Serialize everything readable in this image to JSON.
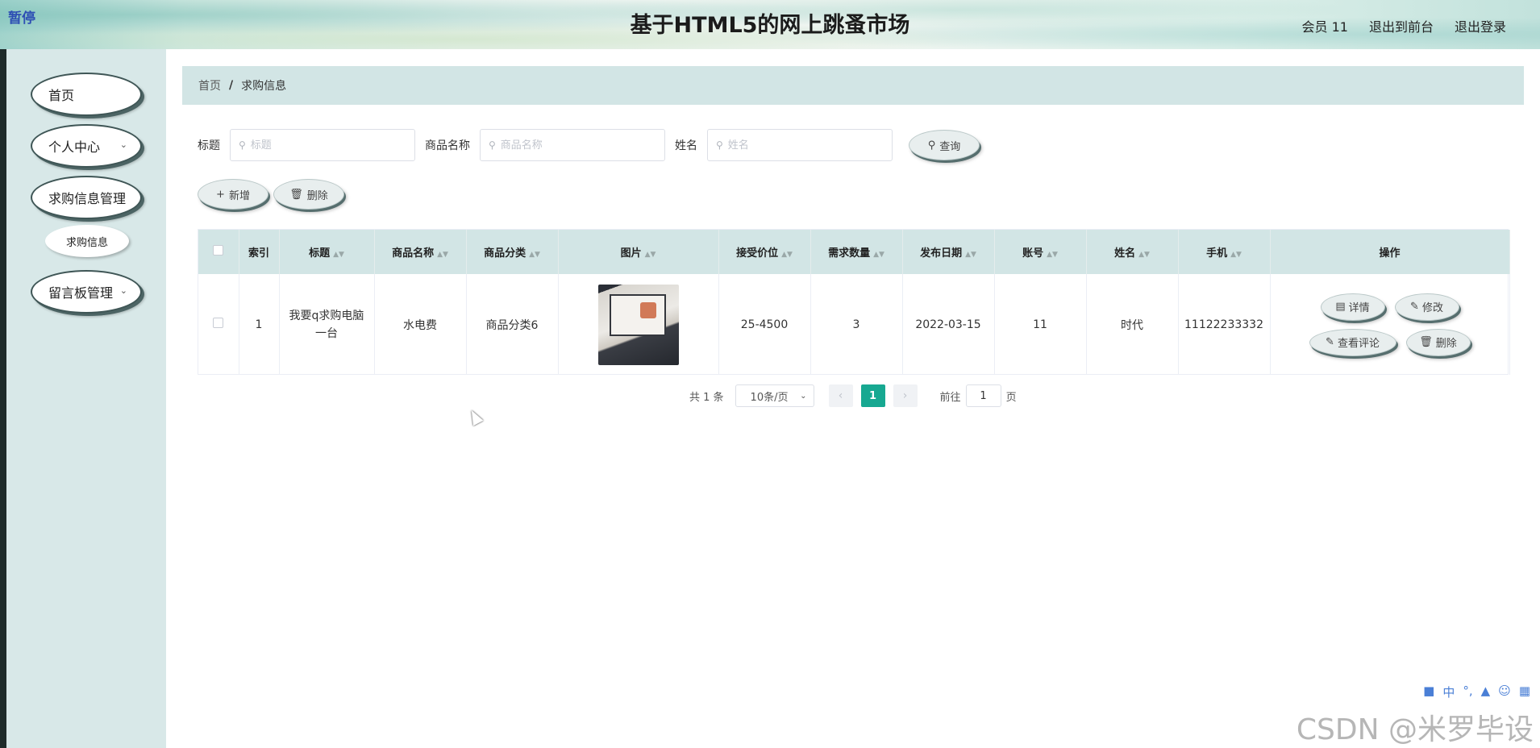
{
  "header": {
    "corner_tag": "暂停",
    "title": "基于HTML5的网上跳蚤市场",
    "user_info": "会员 11",
    "back_to_front": "退出到前台",
    "logout": "退出登录"
  },
  "sidebar": {
    "items": [
      {
        "label": "首页"
      },
      {
        "label": "个人中心",
        "expandable": true
      },
      {
        "label": "求购信息管理"
      },
      {
        "label": "求购信息",
        "sub": true
      },
      {
        "label": "留言板管理",
        "expandable": true
      }
    ]
  },
  "breadcrumb": {
    "home": "首页",
    "separator": "/",
    "current": "求购信息"
  },
  "search": {
    "title_label": "标题",
    "title_placeholder": "标题",
    "product_label": "商品名称",
    "product_placeholder": "商品名称",
    "name_label": "姓名",
    "name_placeholder": "姓名",
    "query_button": "查询"
  },
  "actions": {
    "add": "新增",
    "delete": "删除"
  },
  "table": {
    "headers": [
      "索引",
      "标题",
      "商品名称",
      "商品分类",
      "图片",
      "接受价位",
      "需求数量",
      "发布日期",
      "账号",
      "姓名",
      "手机",
      "操作"
    ],
    "rows": [
      {
        "index": "1",
        "title": "我要q求购电脑一台",
        "product": "水电费",
        "category": "商品分类6",
        "price": "25-4500",
        "quantity": "3",
        "date": "2022-03-15",
        "account": "11",
        "name": "时代",
        "phone": "11122233332"
      }
    ],
    "row_actions": {
      "detail": "详情",
      "edit": "修改",
      "comments": "查看评论",
      "delete": "删除"
    }
  },
  "pagination": {
    "total": "共 1 条",
    "page_size": "10条/页",
    "current_page": "1",
    "goto_label": "前往",
    "goto_value": "1",
    "page_unit": "页"
  },
  "tray": {
    "items": [
      "中",
      "°,"
    ]
  },
  "watermark": "CSDN @米罗毕设",
  "colors": {
    "accent": "#17a891",
    "panel": "#d2e5e5",
    "sidebar": "#d8e8e8"
  }
}
